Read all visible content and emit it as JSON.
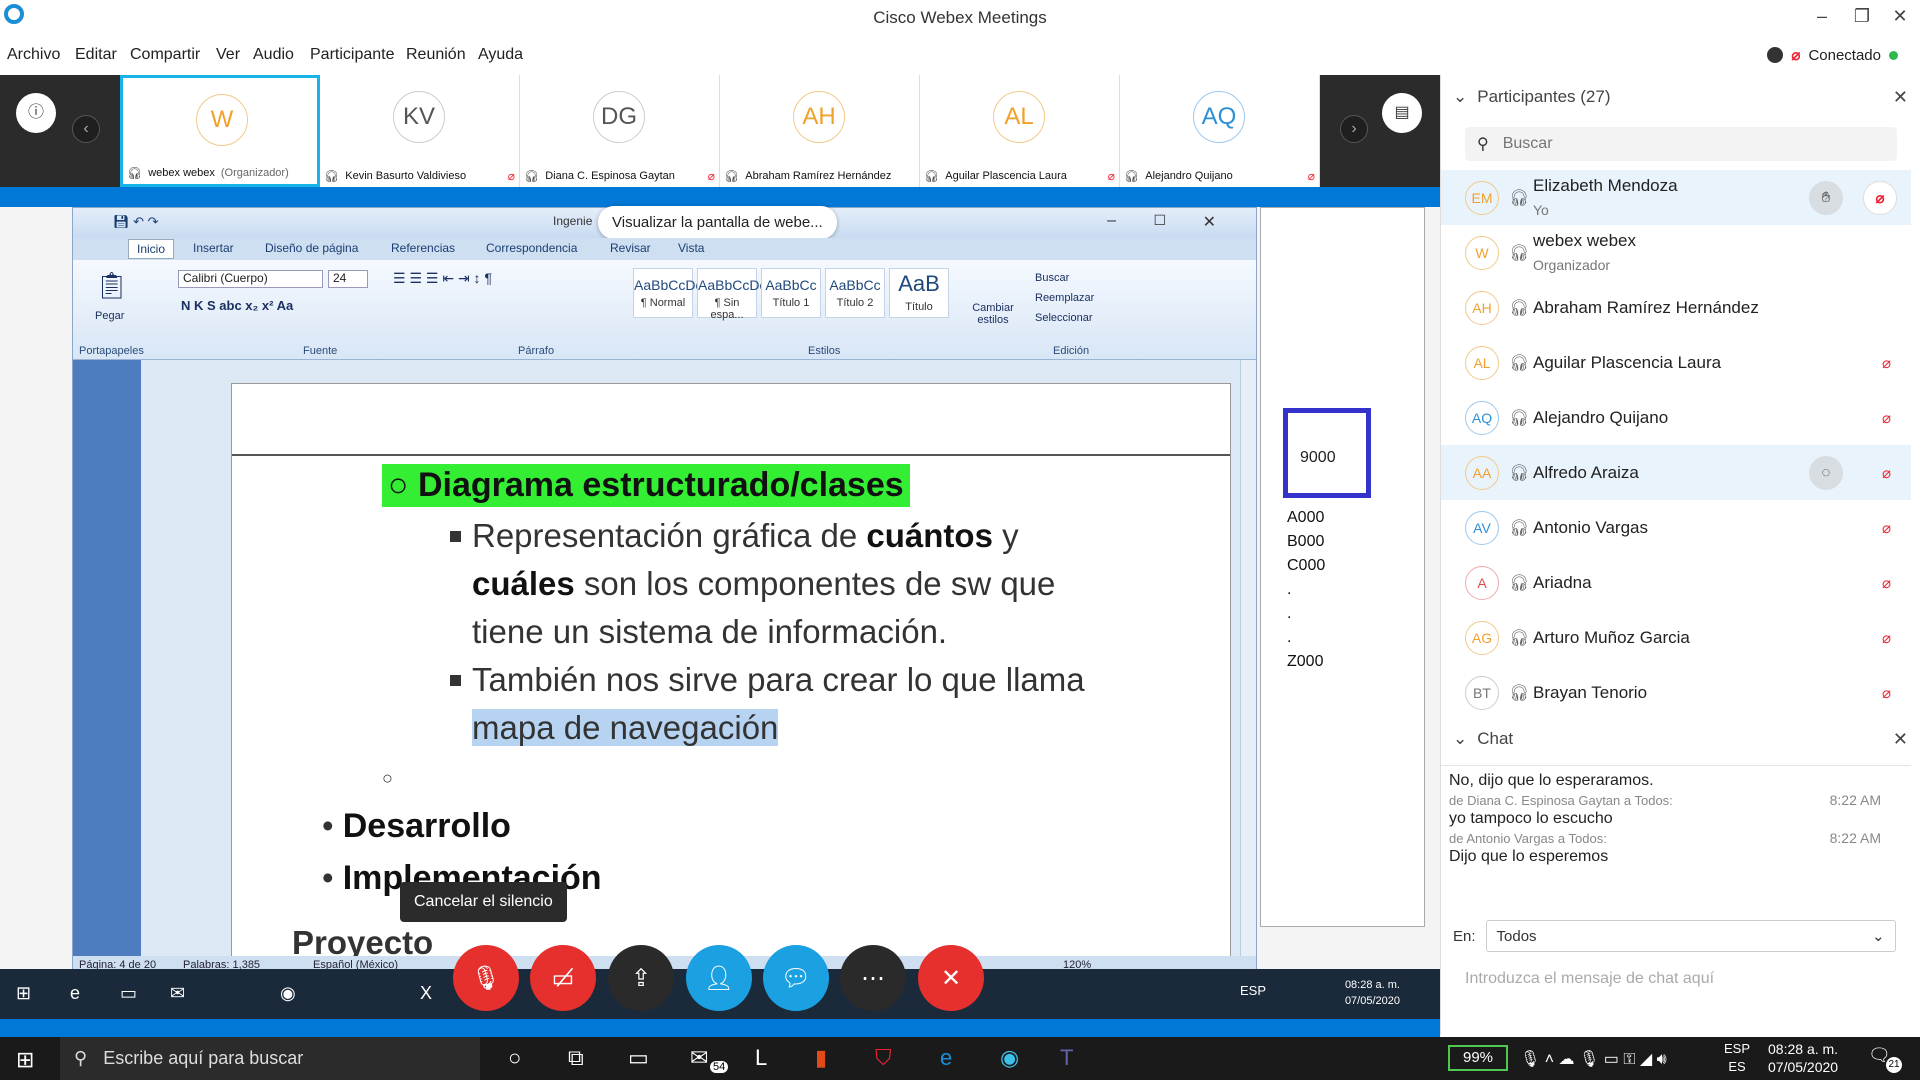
{
  "window": {
    "title": "Cisco Webex Meetings"
  },
  "menu": [
    "Archivo",
    "Editar",
    "Compartir",
    "Ver",
    "Audio",
    "Participante",
    "Reunión",
    "Ayuda"
  ],
  "connection": {
    "status": "Conectado",
    "color": "#2fb84d"
  },
  "strip": {
    "tiles": [
      {
        "initials": "W",
        "name": "webex webex",
        "role": "(Organizador)",
        "color": "orange"
      },
      {
        "initials": "KV",
        "name": "Kevin Basurto Valdivieso",
        "role": "",
        "color": "gray"
      },
      {
        "initials": "DG",
        "name": "Diana C. Espinosa Gaytan",
        "role": "",
        "color": "gray"
      },
      {
        "initials": "AH",
        "name": "Abraham Ramírez Hernández",
        "role": "",
        "color": "orange"
      },
      {
        "initials": "AL",
        "name": "Aguilar Plascencia Laura",
        "role": "",
        "color": "orange"
      },
      {
        "initials": "AQ",
        "name": "Alejandro Quijano",
        "role": "",
        "color": "blue"
      }
    ]
  },
  "shared": {
    "tooltip": "Visualizar la pantalla de webe...",
    "doc_title": "Ingenie",
    "word": {
      "app_menu": "Archivo",
      "tabs": [
        "Inicio",
        "Insertar",
        "Diseño de página",
        "Referencias",
        "Correspondencia",
        "Revisar",
        "Vista"
      ],
      "font": "Calibri (Cuerpo)",
      "size": "24",
      "paste": "Pegar",
      "groups": [
        "Portapapeles",
        "Fuente",
        "Párrafo",
        "Estilos",
        "Edición"
      ],
      "styles": [
        {
          "sample": "AaBbCcDc",
          "caption": "¶ Normal"
        },
        {
          "sample": "AaBbCcDc",
          "caption": "¶ Sin espa..."
        },
        {
          "sample": "AaBbCc",
          "caption": "Título 1"
        },
        {
          "sample": "AaBbCc",
          "caption": "Título 2"
        },
        {
          "sample": "AaB",
          "caption": "Título"
        }
      ],
      "change_styles": "Cambiar estilos",
      "edit_buttons": [
        "Buscar",
        "Reemplazar",
        "Seleccionar"
      ],
      "status": {
        "page": "Página: 4 de 20",
        "words": "Palabras: 1,385",
        "lang": "Español (México)",
        "zoom": "120%"
      }
    },
    "doc": {
      "heading": "Diagrama estructurado/clases",
      "p1_a": "Representación gráfica de ",
      "p1_b": "cuántos",
      "p1_c": " y",
      "p2_a": "cuáles",
      "p2_b": " son los componentes de sw que",
      "p3": "tiene un sistema de información.",
      "p4": "También nos sirve para crear lo que llama",
      "p5": "mapa de navegación",
      "b1": "Desarrollo",
      "b2": "Implementación",
      "cut": "Proyecto"
    },
    "right_doc": {
      "box": "9000",
      "codes": [
        "A000",
        "B000",
        "C000",
        ".",
        ".",
        ".",
        "Z000"
      ]
    },
    "unmute_tip": "Cancelar el silencio",
    "inner_clock": {
      "time": "08:28 a. m.",
      "date": "07/05/2020",
      "lang": "ESP"
    }
  },
  "participants": {
    "title": "Participantes (27)",
    "search_placeholder": "Buscar",
    "list": [
      {
        "initials": "EM",
        "name": "Elizabeth Mendoza",
        "role": "Yo",
        "color": "orange",
        "highlight": true
      },
      {
        "initials": "W",
        "name": "webex webex",
        "role": "Organizador",
        "color": "orange",
        "highlight": false
      },
      {
        "initials": "AH",
        "name": "Abraham Ramírez Hernández",
        "role": "",
        "color": "orange",
        "highlight": false
      },
      {
        "initials": "AL",
        "name": "Aguilar Plascencia Laura",
        "role": "",
        "color": "orange",
        "highlight": false
      },
      {
        "initials": "AQ",
        "name": "Alejandro Quijano",
        "role": "",
        "color": "blue",
        "highlight": false
      },
      {
        "initials": "AA",
        "name": "Alfredo Araiza",
        "role": "",
        "color": "orange",
        "highlight": true
      },
      {
        "initials": "AV",
        "name": "Antonio Vargas",
        "role": "",
        "color": "blue",
        "highlight": false
      },
      {
        "initials": "A",
        "name": "Ariadna",
        "role": "",
        "color": "red",
        "highlight": false
      },
      {
        "initials": "AG",
        "name": "Arturo Muñoz Garcia",
        "role": "",
        "color": "orange",
        "highlight": false
      },
      {
        "initials": "BT",
        "name": "Brayan Tenorio",
        "role": "",
        "color": "gray",
        "highlight": false
      }
    ]
  },
  "chat": {
    "title": "Chat",
    "messages": [
      {
        "text": "No, dijo que lo esperaramos."
      },
      {
        "meta": "de Diana C. Espinosa Gaytan a Todos:",
        "time": "8:22 AM",
        "text": "yo tampoco lo escucho"
      },
      {
        "meta": "de Antonio Vargas a Todos:",
        "time": "8:22 AM",
        "text": "Dijo que lo esperemos"
      }
    ],
    "to_label": "En:",
    "to_value": "Todos",
    "input_placeholder": "Introduzca el mensaje de chat aquí"
  },
  "taskbar": {
    "search_placeholder": "Escribe aquí para buscar",
    "battery": "99%",
    "mail_badge": "54",
    "lang": "ESP",
    "lang_sub": "ES",
    "time": "08:28 a. m.",
    "date": "07/05/2020",
    "notif_count": "21"
  }
}
